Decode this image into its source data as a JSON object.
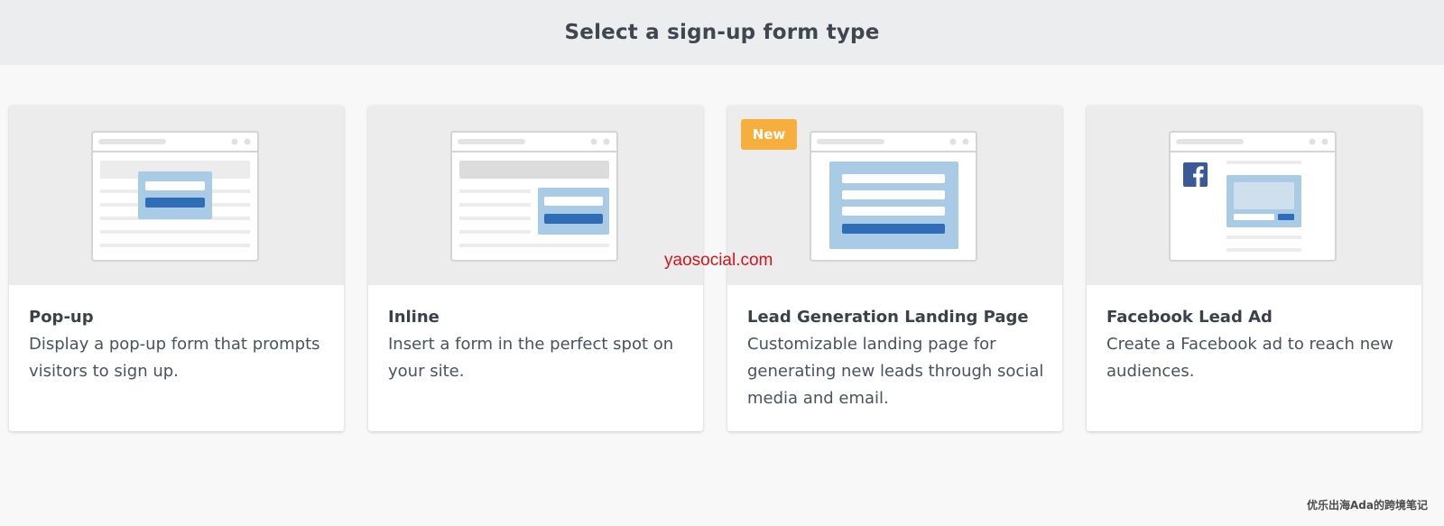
{
  "header": {
    "title": "Select a sign-up form type"
  },
  "cards": [
    {
      "title": "Pop-up",
      "description": "Display a pop-up form that prompts visitors to sign up."
    },
    {
      "title": "Inline",
      "description": "Insert a form in the perfect spot on your site."
    },
    {
      "title": "Lead Generation Landing Page",
      "description": "Customizable landing page for generating new leads through social media and email.",
      "badge": "New"
    },
    {
      "title": "Facebook Lead Ad",
      "description": "Create a Facebook ad to reach new audiences."
    }
  ],
  "watermarks": {
    "center": "yaosocial.com",
    "corner": "优乐出海Ada的跨境笔记"
  },
  "colors": {
    "header_bg": "#ecedef",
    "page_bg": "#f8f8f8",
    "badge": "#f6ae3d",
    "form_light_blue": "#a9cbe6",
    "form_button_blue": "#2f6db6",
    "facebook_blue": "#3b5998",
    "watermark_red": "#d0161b"
  },
  "icons": [
    "facebook-icon"
  ]
}
